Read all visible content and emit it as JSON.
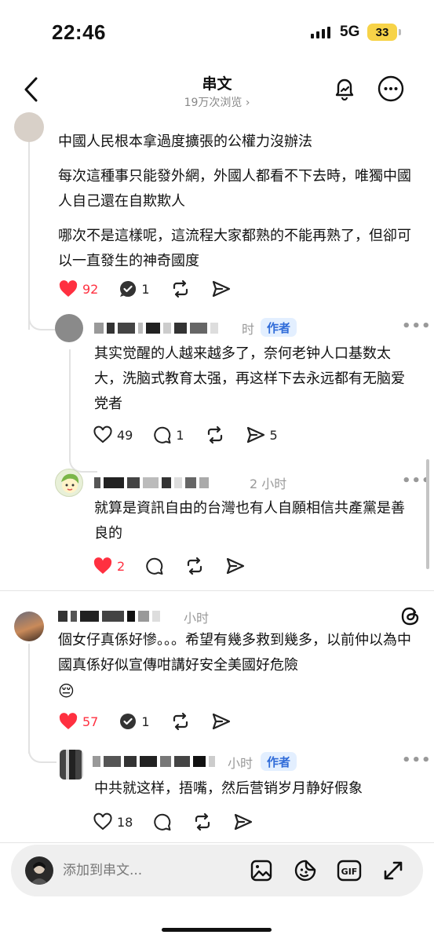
{
  "status_bar": {
    "time": "22:46",
    "network": "5G",
    "battery": "33"
  },
  "header": {
    "title": "串文",
    "subtitle": "19万次浏览 ›"
  },
  "posts": [
    {
      "paragraphs": [
        "中國人民根本拿過度擴張的公權力沒辦法",
        "每次這種事只能發外網，外國人都看不下去時，唯獨中國人自己還在自欺欺人",
        "哪次不是這樣呢，這流程大家都熟的不能再熟了，但卻可以一直發生的神奇國度"
      ],
      "likes": "92",
      "replies": "1"
    },
    {
      "time": "时",
      "badge": "作者",
      "text": "其实觉醒的人越来越多了，奈何老钟人口基数太大，洗脑式教育太强，再这样下去永远都有无脑爱党者",
      "likes": "49",
      "replies": "1",
      "shares": "5"
    },
    {
      "time": "2 小时",
      "text": "就算是資訊自由的台灣也有人自願相信共產黨是善良的",
      "likes": "2"
    },
    {
      "time": "小时",
      "text": "個女仔真係好慘。。。希望有幾多救到幾多，以前仲以為中國真係好似宣傳咁講好安全美國好危險",
      "emoji": "😔",
      "likes": "57",
      "replies": "1"
    },
    {
      "time": "小时",
      "badge": "作者",
      "text": "中共就这样，捂嘴，然后营销岁月静好假象",
      "likes": "18"
    }
  ],
  "composer": {
    "placeholder": "添加到串文..."
  },
  "colors": {
    "like_red": "#ff3040",
    "badge_blue": "#2f6bd8",
    "badge_bg": "#e3efff",
    "battery": "#f7d348"
  }
}
